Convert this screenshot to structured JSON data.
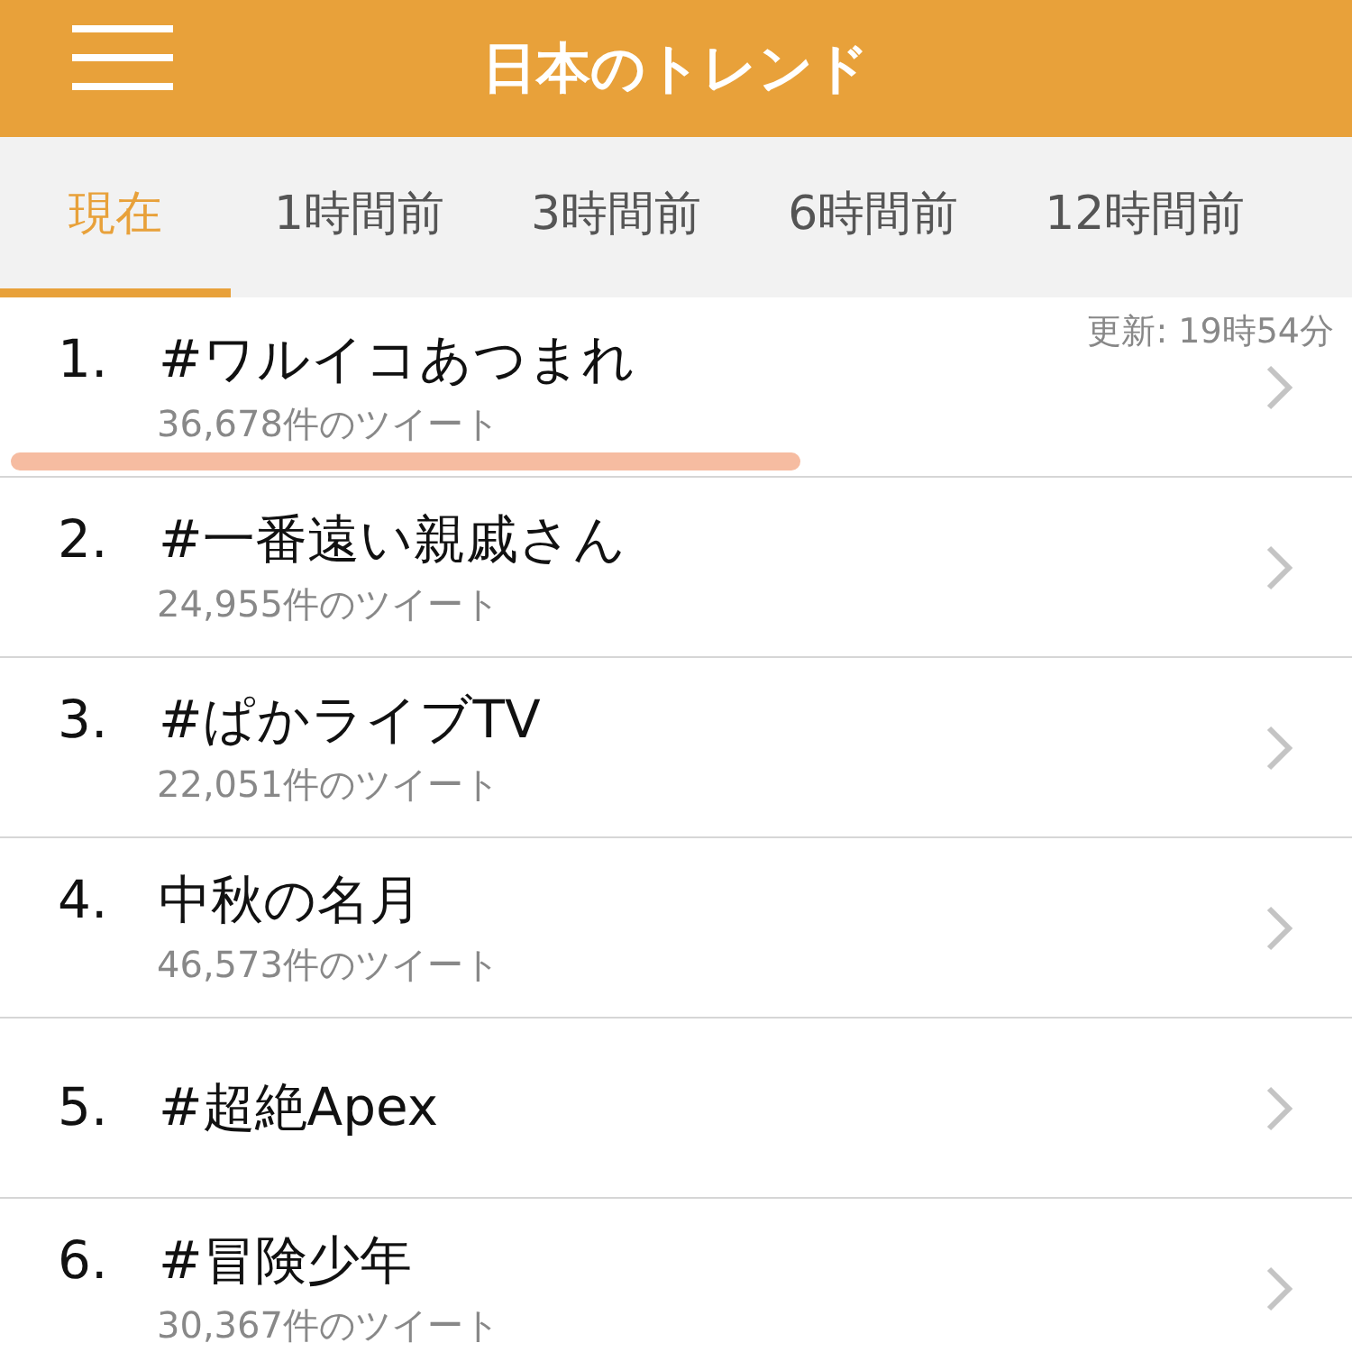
{
  "header": {
    "title": "日本のトレンド"
  },
  "tabs": [
    {
      "label": "現在",
      "selected": true
    },
    {
      "label": "1時間前",
      "selected": false
    },
    {
      "label": "3時間前",
      "selected": false
    },
    {
      "label": "6時間前",
      "selected": false
    },
    {
      "label": "12時間前",
      "selected": false
    }
  ],
  "updated": "更新: 19時54分",
  "trends": [
    {
      "rank": "1.",
      "name": "#ワルイコあつまれ",
      "count": "36,678件のツイート"
    },
    {
      "rank": "2.",
      "name": "#一番遠い親戚さん",
      "count": "24,955件のツイート"
    },
    {
      "rank": "3.",
      "name": "#ぱかライブTV",
      "count": "22,051件のツイート"
    },
    {
      "rank": "4.",
      "name": "中秋の名月",
      "count": "46,573件のツイート"
    },
    {
      "rank": "5.",
      "name": "#超絶Apex"
    },
    {
      "rank": "6.",
      "name": "#冒険少年",
      "count": "30,367件のツイート"
    }
  ]
}
